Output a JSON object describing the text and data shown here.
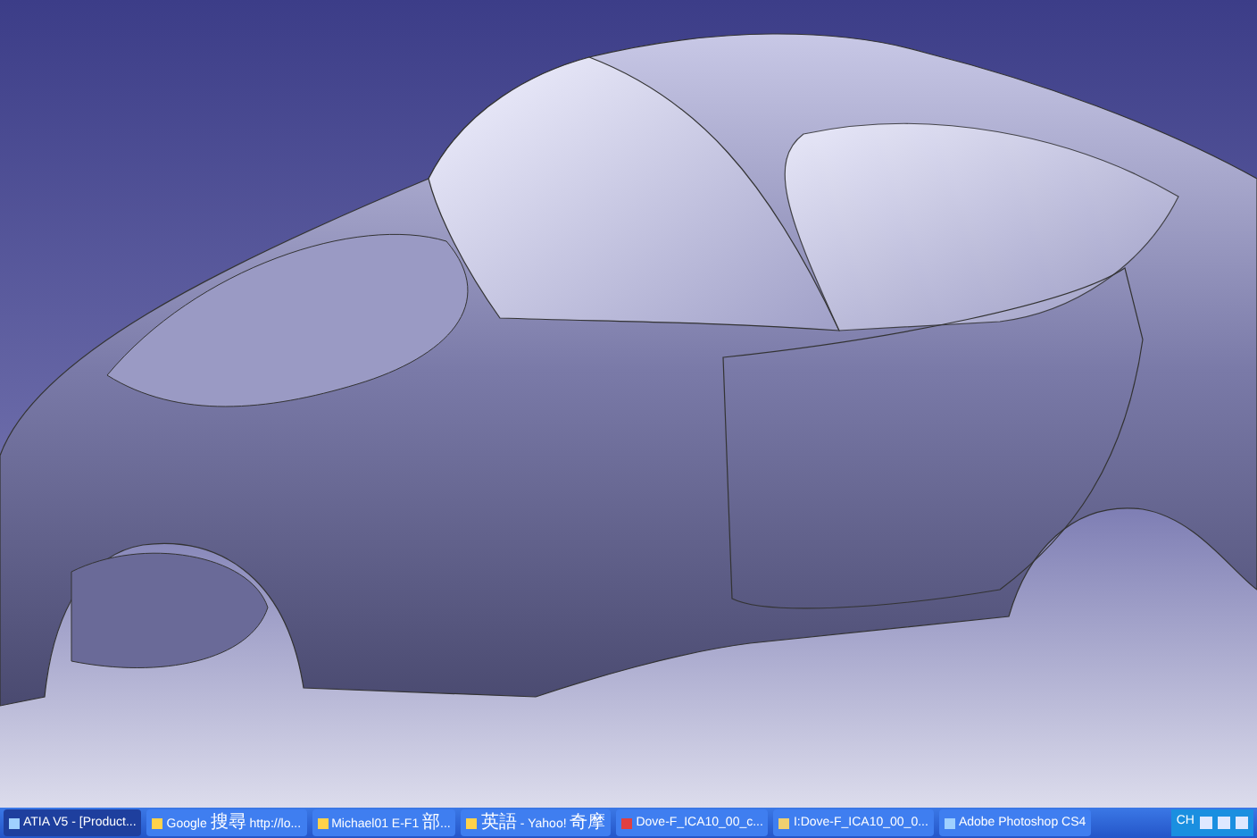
{
  "taskbar": {
    "buttons": [
      {
        "label": "ATIA V5 - [Product...",
        "selected": true,
        "kind": "app"
      },
      {
        "label": "Google 搜尋 http://lo...",
        "selected": false,
        "kind": "browser"
      },
      {
        "label": "Michael01 E-F1 部...",
        "selected": false,
        "kind": "browser"
      },
      {
        "label": "英語 - Yahoo! 奇摩",
        "selected": false,
        "kind": "browser"
      },
      {
        "label": "Dove-F_ICA10_00_c...",
        "selected": false,
        "kind": "document"
      },
      {
        "label": "I:Dove-F_ICA10_00_0...",
        "selected": false,
        "kind": "folder"
      },
      {
        "label": "Adobe Photoshop CS4",
        "selected": false,
        "kind": "app"
      }
    ],
    "tray": {
      "language": "CH"
    }
  }
}
